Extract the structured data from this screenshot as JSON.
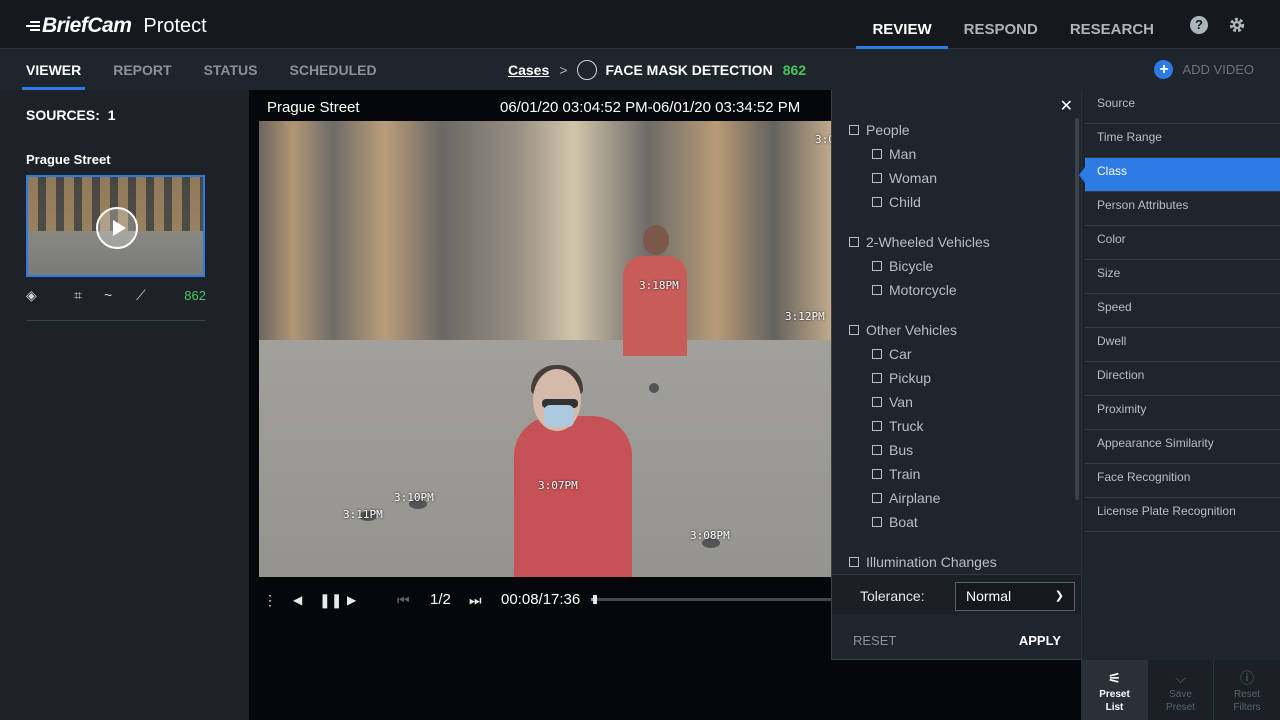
{
  "header": {
    "brand": "BriefCam",
    "product": "Protect",
    "nav": [
      {
        "label": "REVIEW",
        "active": true
      },
      {
        "label": "RESPOND",
        "active": false
      },
      {
        "label": "RESEARCH",
        "active": false
      }
    ],
    "help_icon": "question-circle-icon",
    "settings_icon": "gear-icon"
  },
  "subnav": {
    "tabs": [
      {
        "label": "VIEWER",
        "active": true
      },
      {
        "label": "REPORT",
        "active": false
      },
      {
        "label": "STATUS",
        "active": false
      },
      {
        "label": "SCHEDULED",
        "active": false
      }
    ],
    "breadcrumb": {
      "root": "Cases",
      "separator": ">",
      "case_name": "FACE MASK DETECTION",
      "count": "862"
    },
    "add_video": "ADD VIDEO"
  },
  "sources": {
    "label": "SOURCES:",
    "count": "1",
    "item": {
      "name": "Prague Street",
      "count": "862"
    }
  },
  "viewer": {
    "camera": "Prague Street",
    "time_range": "06/01/20 03:04:52 PM-06/01/20 03:34:52 PM",
    "timestamps": [
      "3:18PM",
      "3:12PM",
      "3:10PM",
      "3:11PM",
      "3:07PM",
      "3:08PM",
      "3:0"
    ],
    "page": "1/2",
    "time": "00:08/17:36",
    "progress": 0.008
  },
  "class_filter": {
    "groups": [
      {
        "label": "People",
        "items": [
          "Man",
          "Woman",
          "Child"
        ]
      },
      {
        "label": "2-Wheeled Vehicles",
        "items": [
          "Bicycle",
          "Motorcycle"
        ]
      },
      {
        "label": "Other Vehicles",
        "items": [
          "Car",
          "Pickup",
          "Van",
          "Truck",
          "Bus",
          "Train",
          "Airplane",
          "Boat"
        ]
      },
      {
        "label": "Illumination Changes",
        "items": []
      }
    ],
    "tolerance_label": "Tolerance:",
    "tolerance_value": "Normal",
    "reset": "RESET",
    "apply": "APPLY"
  },
  "filter_menu": {
    "items": [
      "Source",
      "Time Range",
      "Class",
      "Person Attributes",
      "Color",
      "Size",
      "Speed",
      "Dwell",
      "Direction",
      "Proximity",
      "Appearance Similarity",
      "Face Recognition",
      "License Plate Recognition"
    ],
    "active": "Class"
  },
  "bottom_actions": [
    {
      "line1": "Preset",
      "line2": "List",
      "icon": "sliders-icon",
      "enabled": true
    },
    {
      "line1": "Save",
      "line2": "Preset",
      "icon": "chevron-down-icon",
      "enabled": false
    },
    {
      "line1": "Reset",
      "line2": "Filters",
      "icon": "alert-circle-icon",
      "enabled": false
    }
  ],
  "colors": {
    "accent": "#2d7be5",
    "count_green": "#49c55d",
    "panel": "#1f252c",
    "topbar": "#15191e"
  }
}
